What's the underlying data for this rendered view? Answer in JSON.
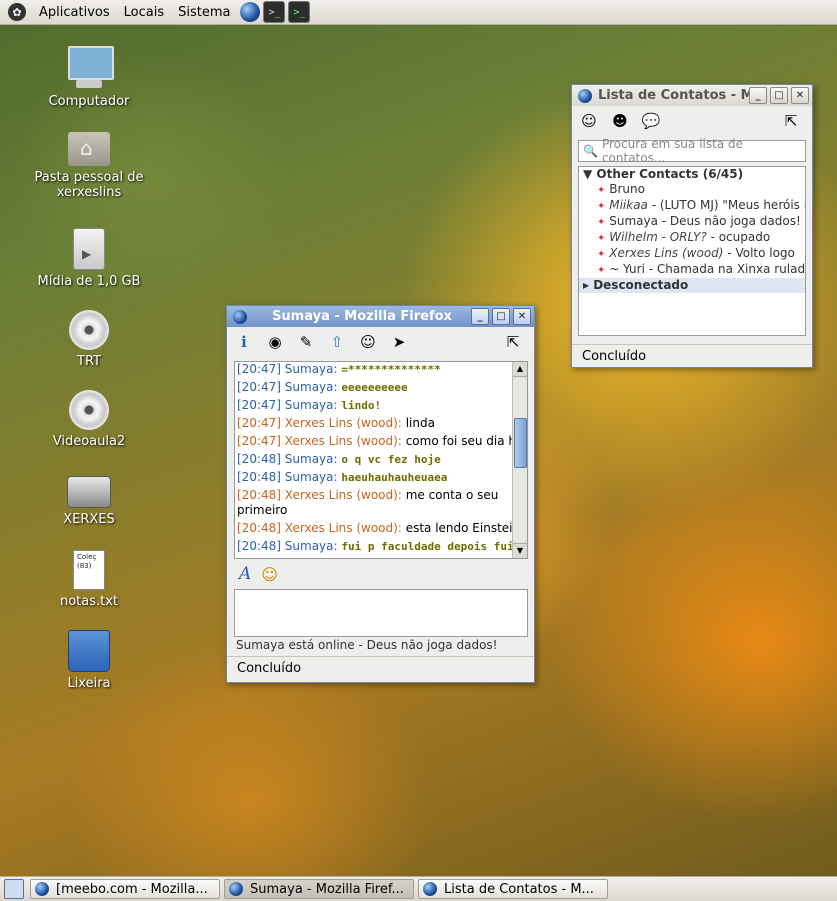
{
  "top_panel": {
    "menus": [
      "Aplicativos",
      "Locais",
      "Sistema"
    ]
  },
  "desktop": {
    "icons": [
      {
        "label": "Computador",
        "icon": "computer-icon"
      },
      {
        "label": "Pasta pessoal de xerxeslins",
        "icon": "home-folder-icon"
      },
      {
        "label": "Mídia de 1,0 GB",
        "icon": "removable-media-icon"
      },
      {
        "label": "TRT",
        "icon": "cd-icon"
      },
      {
        "label": "Videoaula2",
        "icon": "cd-icon"
      },
      {
        "label": "XERXES",
        "icon": "hard-drive-icon"
      },
      {
        "label": "notas.txt",
        "icon": "text-file-icon"
      },
      {
        "label": "Lixeira",
        "icon": "trash-icon"
      }
    ],
    "notas_preview": "Coleç (83)"
  },
  "chat_window": {
    "title": "Sumaya - Mozilla Firefox",
    "messages": [
      {
        "time": "[20:47]",
        "sender": "Sumaya:",
        "text": "=**************",
        "from_me": false
      },
      {
        "time": "[20:47]",
        "sender": "Sumaya:",
        "text": "eeeeeeeeee",
        "from_me": false
      },
      {
        "time": "[20:47]",
        "sender": "Sumaya:",
        "text": "lindo!",
        "from_me": false
      },
      {
        "time": "[20:47]",
        "sender": "Xerxes Lins (wood):",
        "text": "linda",
        "from_me": true
      },
      {
        "time": "[20:47]",
        "sender": "Xerxes Lins (wood):",
        "text": "como foi seu dia hj?",
        "from_me": true
      },
      {
        "time": "[20:48]",
        "sender": "Sumaya:",
        "text": "o q vc fez hoje",
        "from_me": false
      },
      {
        "time": "[20:48]",
        "sender": "Sumaya:",
        "text": "haeuhauhauheuaea",
        "from_me": false
      },
      {
        "time": "[20:48]",
        "sender": "Xerxes Lins (wood):",
        "text": "me conta o seu primeiro",
        "from_me": true
      },
      {
        "time": "[20:48]",
        "sender": "Xerxes Lins (wood):",
        "text": "esta lendo Einstein?",
        "from_me": true
      },
      {
        "time": "[20:48]",
        "sender": "Sumaya:",
        "text": "fui p faculdade depois fui",
        "from_me": false
      }
    ],
    "input_value": "",
    "presence": "Sumaya está online - Deus não joga dados!",
    "status": "Concluído"
  },
  "contacts_window": {
    "title": "Lista de Contatos - M",
    "search_placeholder": "Procura em sua lista de contatos...",
    "groups": [
      {
        "name": "Other Contacts (6/45)",
        "expanded": true,
        "contacts": [
          {
            "name": "Bruno",
            "status": ""
          },
          {
            "name": "Miikaa",
            "status": " - (LUTO MJ) \"Meus heróis mo"
          },
          {
            "name": "Sumaya",
            "status": " - Deus não joga dados!"
          },
          {
            "name": "Wilhelm - ORLY?",
            "status": " - ocupado"
          },
          {
            "name": "Xerxes Lins (wood)",
            "status": " - Volto logo"
          },
          {
            "name": "~ Yuri",
            "status": " - Chamada na Xinxa rulada!"
          }
        ]
      },
      {
        "name": "Desconectado",
        "expanded": false,
        "contacts": []
      }
    ],
    "status": "Concluído"
  },
  "taskbar": {
    "tasks": [
      "[meebo.com - Mozilla...",
      "Sumaya - Mozilla Firef...",
      "Lista de Contatos - M..."
    ]
  }
}
